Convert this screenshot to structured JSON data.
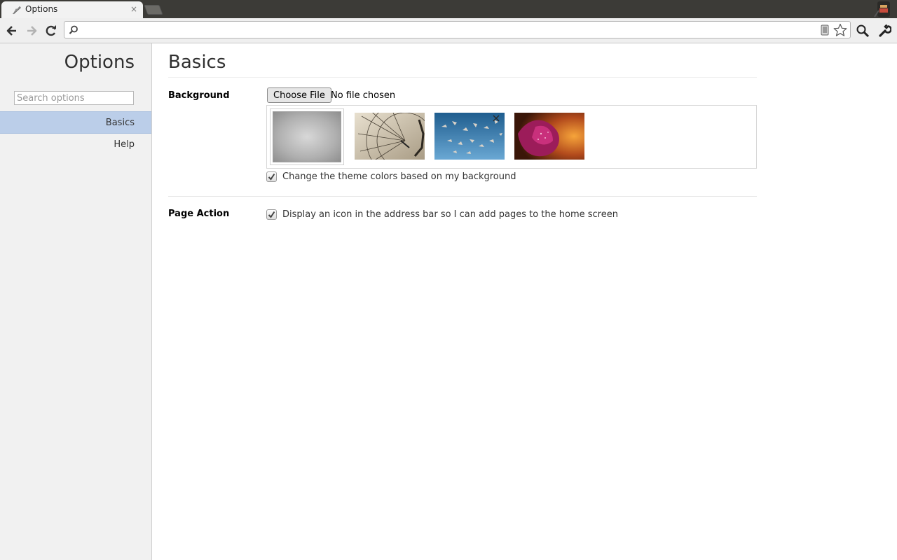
{
  "browser": {
    "tab_title": "Options",
    "tab_close": "×",
    "omnibox_value": ""
  },
  "sidebar": {
    "title": "Options",
    "search_placeholder": "Search options",
    "items": [
      {
        "label": "Basics",
        "selected": true
      },
      {
        "label": "Help",
        "selected": false
      }
    ]
  },
  "main": {
    "page_title": "Basics",
    "background": {
      "label": "Background",
      "choose_file_label": "Choose File",
      "file_status": "No file chosen",
      "thumbnails": [
        {
          "name": "gray-gradient",
          "selected": true
        },
        {
          "name": "ferris-wheel",
          "selected": false
        },
        {
          "name": "birds-in-sky",
          "selected": false
        },
        {
          "name": "pink-flower",
          "selected": false
        }
      ],
      "theme_checkbox_label": "Change the theme colors based on my background",
      "theme_checked": true
    },
    "page_action": {
      "label": "Page Action",
      "checkbox_label": "Display an icon in the address bar so I can add pages to the home screen",
      "checked": true
    }
  },
  "colors": {
    "tabstrip": "#3c3b37",
    "sidebar_bg": "#f1f1f1",
    "selected_nav": "#bbcee9"
  }
}
